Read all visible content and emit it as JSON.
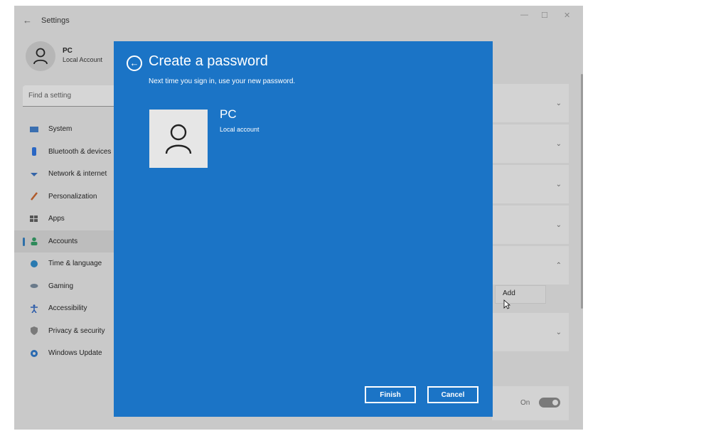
{
  "window": {
    "title": "Settings",
    "back_glyph": "←",
    "minimize_glyph": "—",
    "maximize_glyph": "☐",
    "close_glyph": "✕"
  },
  "profile": {
    "name": "PC",
    "account_type": "Local Account",
    "avatar_icon": "person-icon"
  },
  "search": {
    "placeholder": "Find a setting"
  },
  "sidebar": {
    "items": [
      {
        "label": "System",
        "icon": "monitor-icon",
        "color": "#3a6fb0"
      },
      {
        "label": "Bluetooth & devices",
        "icon": "bluetooth-icon",
        "color": "#2a67c4"
      },
      {
        "label": "Network & internet",
        "icon": "wifi-icon",
        "color": "#3464a8"
      },
      {
        "label": "Personalization",
        "icon": "brush-icon",
        "color": "#b05a2a"
      },
      {
        "label": "Apps",
        "icon": "apps-icon",
        "color": "#555555"
      },
      {
        "label": "Accounts",
        "icon": "accounts-icon",
        "color": "#2e8a5a",
        "active": true
      },
      {
        "label": "Time & language",
        "icon": "globe-icon",
        "color": "#2a7ab0"
      },
      {
        "label": "Gaming",
        "icon": "controller-icon",
        "color": "#6a7a8a"
      },
      {
        "label": "Accessibility",
        "icon": "accessibility-icon",
        "color": "#2a5aa8"
      },
      {
        "label": "Privacy & security",
        "icon": "shield-icon",
        "color": "#7a7a7a"
      },
      {
        "label": "Windows Update",
        "icon": "update-icon",
        "color": "#2a6ab0"
      }
    ]
  },
  "content": {
    "add_label": "Add",
    "toggle_label": "On",
    "chevron_down": "⌄",
    "chevron_up": "⌃"
  },
  "dialog": {
    "title": "Create a password",
    "subtitle": "Next time you sign in, use your new password.",
    "user_name": "PC",
    "user_type": "Local account",
    "back_glyph": "←",
    "finish_label": "Finish",
    "cancel_label": "Cancel",
    "background_color": "#1b74c6"
  }
}
